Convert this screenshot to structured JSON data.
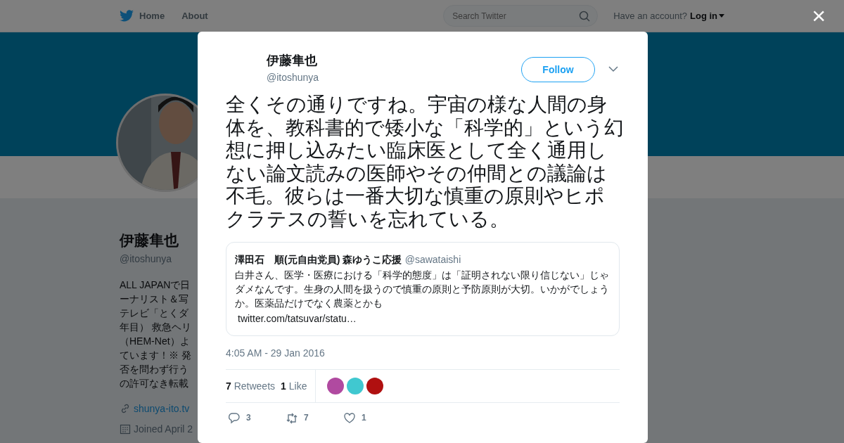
{
  "nav": {
    "items": [
      {
        "label": "Home"
      },
      {
        "label": "About"
      }
    ],
    "search": {
      "placeholder": "Search Twitter"
    },
    "account_prompt": "Have an account?",
    "login": "Log in"
  },
  "profile": {
    "name": "伊藤隼也",
    "handle": "@itoshunya",
    "bio_lines": [
      "ALL JAPANで日",
      "ーナリスト＆写",
      "テレビ「とくダ",
      "年目） 救急ヘリ",
      "（HEM-Net）よ",
      "ています！※ 発",
      "否を問わず行う",
      "の許可なき転載"
    ],
    "website": "shunya-ito.tv",
    "joined": "Joined April 2"
  },
  "modal": {
    "close": "×",
    "author": {
      "name": "伊藤隼也",
      "handle": "@itoshunya"
    },
    "follow": "Follow",
    "text": "全くその通りですね。宇宙の様な人間の身体を、教科書的で矮小な「科学的」という幻想に押し込みたい臨床医として全く通用しない論文読みの医師やその仲間との議論は不毛。彼らは一番大切な慎重の原則やヒポクラテスの誓いを忘れている。",
    "quote": {
      "name": "澤田石　順(元自由党員) 森ゆうこ応援",
      "handle": "@sawataishi",
      "text": "白井さん、医学・医療における「科学的態度」は「証明されない限り信じない」じゃダメなんです。生身の人間を扱うので慎重の原則と予防原則が大切。いかがでしょうか。医薬品だけでなく農薬とかも",
      "link": "twitter.com/tatsuvar/statu…"
    },
    "time": "4:05 AM - 29 Jan 2016",
    "stats": [
      {
        "count": "7",
        "label": "Retweets"
      },
      {
        "count": "1",
        "label": "Like"
      }
    ],
    "likers": [
      {
        "color": "#b04aa0"
      },
      {
        "color": "#40c8d0"
      },
      {
        "color": "#b01010"
      }
    ],
    "actions": [
      {
        "kind": "reply",
        "count": "3"
      },
      {
        "kind": "retweet",
        "count": "7"
      },
      {
        "kind": "like",
        "count": "1"
      }
    ]
  }
}
